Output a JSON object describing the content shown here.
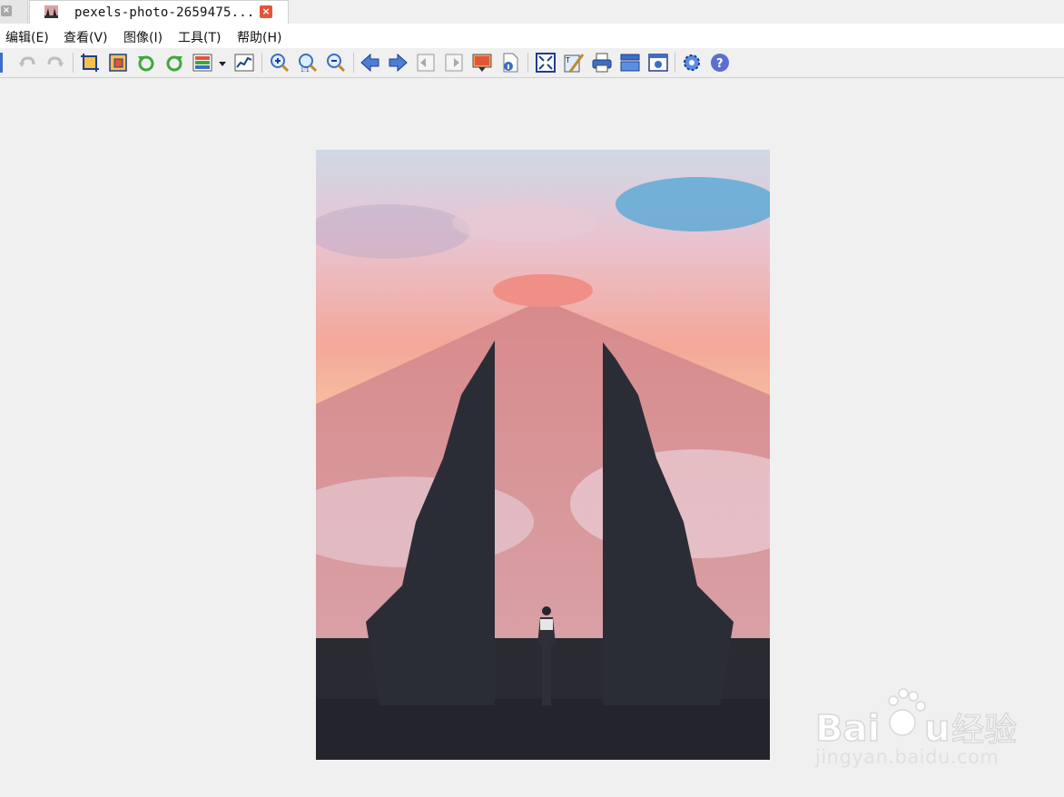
{
  "tabs": {
    "previous_close": "×",
    "active_title": "pexels-photo-2659475...",
    "active_close": "×"
  },
  "menu": {
    "items": [
      "编辑(E)",
      "查看(V)",
      "图像(I)",
      "工具(T)",
      "帮助(H)"
    ]
  },
  "toolbar": {
    "buttons": [
      "undo-icon",
      "redo-icon",
      "crop-icon",
      "resize-icon",
      "rotate-left-icon",
      "rotate-right-icon",
      "color-adjust-icon",
      "histogram-icon",
      "zoom-in-icon",
      "actual-size-icon",
      "zoom-out-icon",
      "previous-icon",
      "next-icon",
      "first-page-icon",
      "last-page-icon",
      "slideshow-icon",
      "file-info-icon",
      "fit-window-icon",
      "paint-icon",
      "print-icon",
      "scan-icon",
      "screenshot-icon",
      "settings-icon",
      "help-icon"
    ]
  },
  "watermark": {
    "brand": "Baidu",
    "brand_cn": "经验",
    "url": "jingyan.baidu.com"
  },
  "colors": {
    "app_background": "#f0f0f0",
    "tab_close": "#e2553a",
    "icon_blue": "#3a6fc4"
  }
}
